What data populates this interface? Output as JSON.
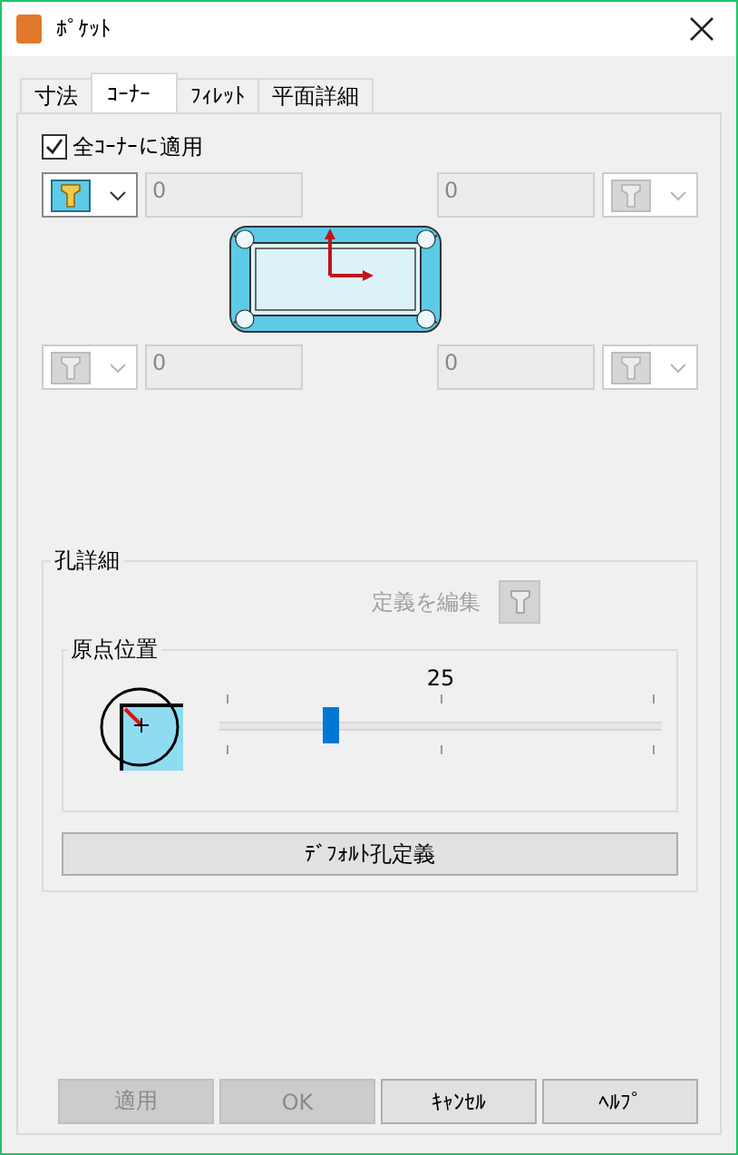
{
  "window": {
    "title": "ﾎﾟｹｯﾄ"
  },
  "tabs": [
    {
      "label": "寸法",
      "selected": false
    },
    {
      "label": "ｺｰﾅｰ",
      "selected": true
    },
    {
      "label": "ﾌｨﾚｯﾄ",
      "selected": false
    },
    {
      "label": "平面詳細",
      "selected": false
    }
  ],
  "apply_all": {
    "label": "全ｺｰﾅｰに適用",
    "checked": true
  },
  "corners": [
    {
      "value": "0",
      "disabled": false
    },
    {
      "value": "0",
      "disabled": true
    },
    {
      "value": "0",
      "disabled": true
    },
    {
      "value": "0",
      "disabled": true
    }
  ],
  "hole_details": {
    "title": "孔詳細",
    "edit_label": "定義を編集",
    "edit_disabled": true,
    "origin": {
      "title": "原点位置",
      "reading": "25",
      "level": 0.25
    },
    "default_button": "ﾃﾞﾌｫﾙﾄ孔定義"
  },
  "buttons": [
    {
      "label": "適用",
      "disabled": true
    },
    {
      "label": "OK",
      "disabled": true
    },
    {
      "label": "ｷｬﾝｾﾙ",
      "disabled": false
    },
    {
      "label": "ﾍﾙﾌﾟ",
      "disabled": false
    }
  ]
}
